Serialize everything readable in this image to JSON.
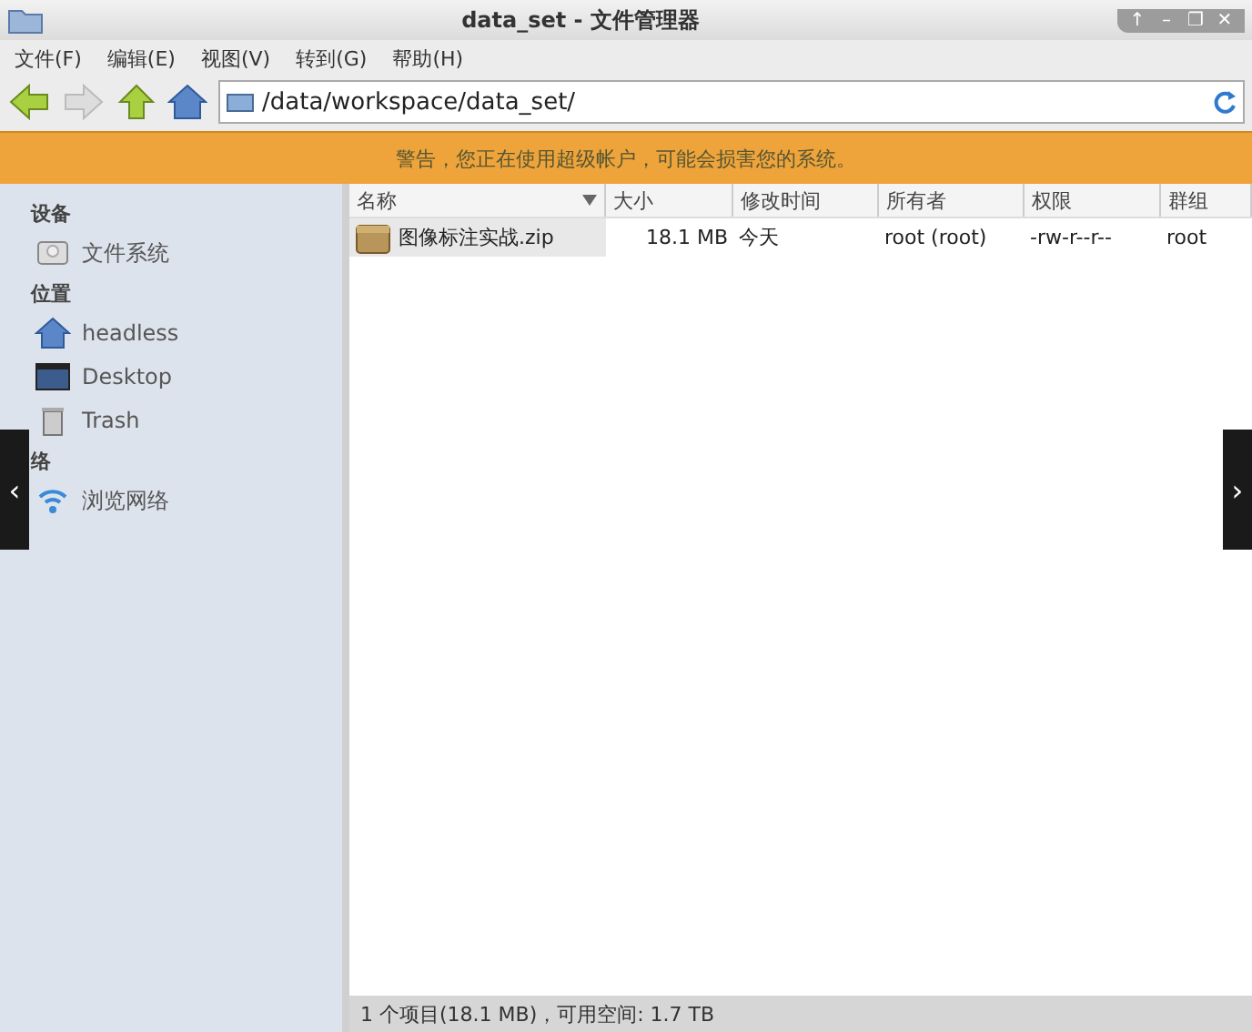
{
  "window": {
    "title": "data_set - 文件管理器",
    "controls": [
      "↑",
      "–",
      "❐",
      "✕"
    ]
  },
  "menu": [
    "文件(F)",
    "编辑(E)",
    "视图(V)",
    "转到(G)",
    "帮助(H)"
  ],
  "toolbar": {
    "back_disabled": false,
    "forward_disabled": true,
    "location": "/data/workspace/data_set/"
  },
  "warning": "警告，您正在使用超级帐户，可能会损害您的系统。",
  "sidebar": {
    "sections": [
      {
        "title": "设备",
        "items": [
          {
            "label": "文件系统",
            "kind": "drive"
          }
        ]
      },
      {
        "title": "位置",
        "items": [
          {
            "label": "headless",
            "kind": "home"
          },
          {
            "label": "Desktop",
            "kind": "desktop"
          },
          {
            "label": "Trash",
            "kind": "trash"
          }
        ]
      },
      {
        "title": "络",
        "items": [
          {
            "label": "浏览网络",
            "kind": "network"
          }
        ]
      }
    ]
  },
  "table": {
    "columns": [
      "名称",
      "大小",
      "修改时间",
      "所有者",
      "权限",
      "群组"
    ],
    "rows": [
      {
        "cells": [
          "图像标注实战.zip",
          "18.1 MB",
          "今天",
          "root (root)",
          "-rw-r--r--",
          "root"
        ],
        "selected": true
      }
    ]
  },
  "overlay_arrows": [
    "‹",
    "›"
  ],
  "status_bar": "1 个项目(18.1 MB)，可用空间: 1.7 TB"
}
